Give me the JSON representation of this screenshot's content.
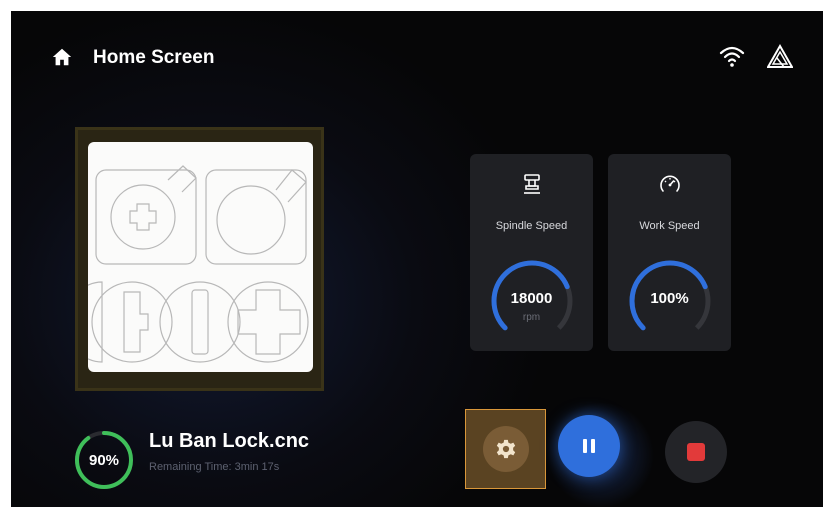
{
  "header": {
    "title": "Home Screen",
    "home_icon": "home-icon",
    "wifi_icon": "wifi-icon",
    "brand_icon": "brand-logo-icon"
  },
  "job": {
    "progress_percent": 90,
    "progress_label": "90%",
    "file_name": "Lu Ban Lock.cnc",
    "remaining": "Remaining Time: 3min 17s"
  },
  "spindle": {
    "label": "Spindle Speed",
    "value": "18000",
    "unit": "rpm",
    "icon": "spindle-icon",
    "gauge_fraction": 0.75
  },
  "work": {
    "label": "Work Speed",
    "value": "100%",
    "icon": "speedometer-icon",
    "gauge_fraction": 0.75
  },
  "controls": {
    "settings_icon": "gear-icon",
    "pause_icon": "pause-icon",
    "stop_icon": "stop-icon"
  },
  "colors": {
    "accent_blue": "#2f6fdc",
    "progress_green": "#3fbf5a",
    "stop_red": "#e23a3a",
    "settings_highlight": "#d9973a"
  }
}
